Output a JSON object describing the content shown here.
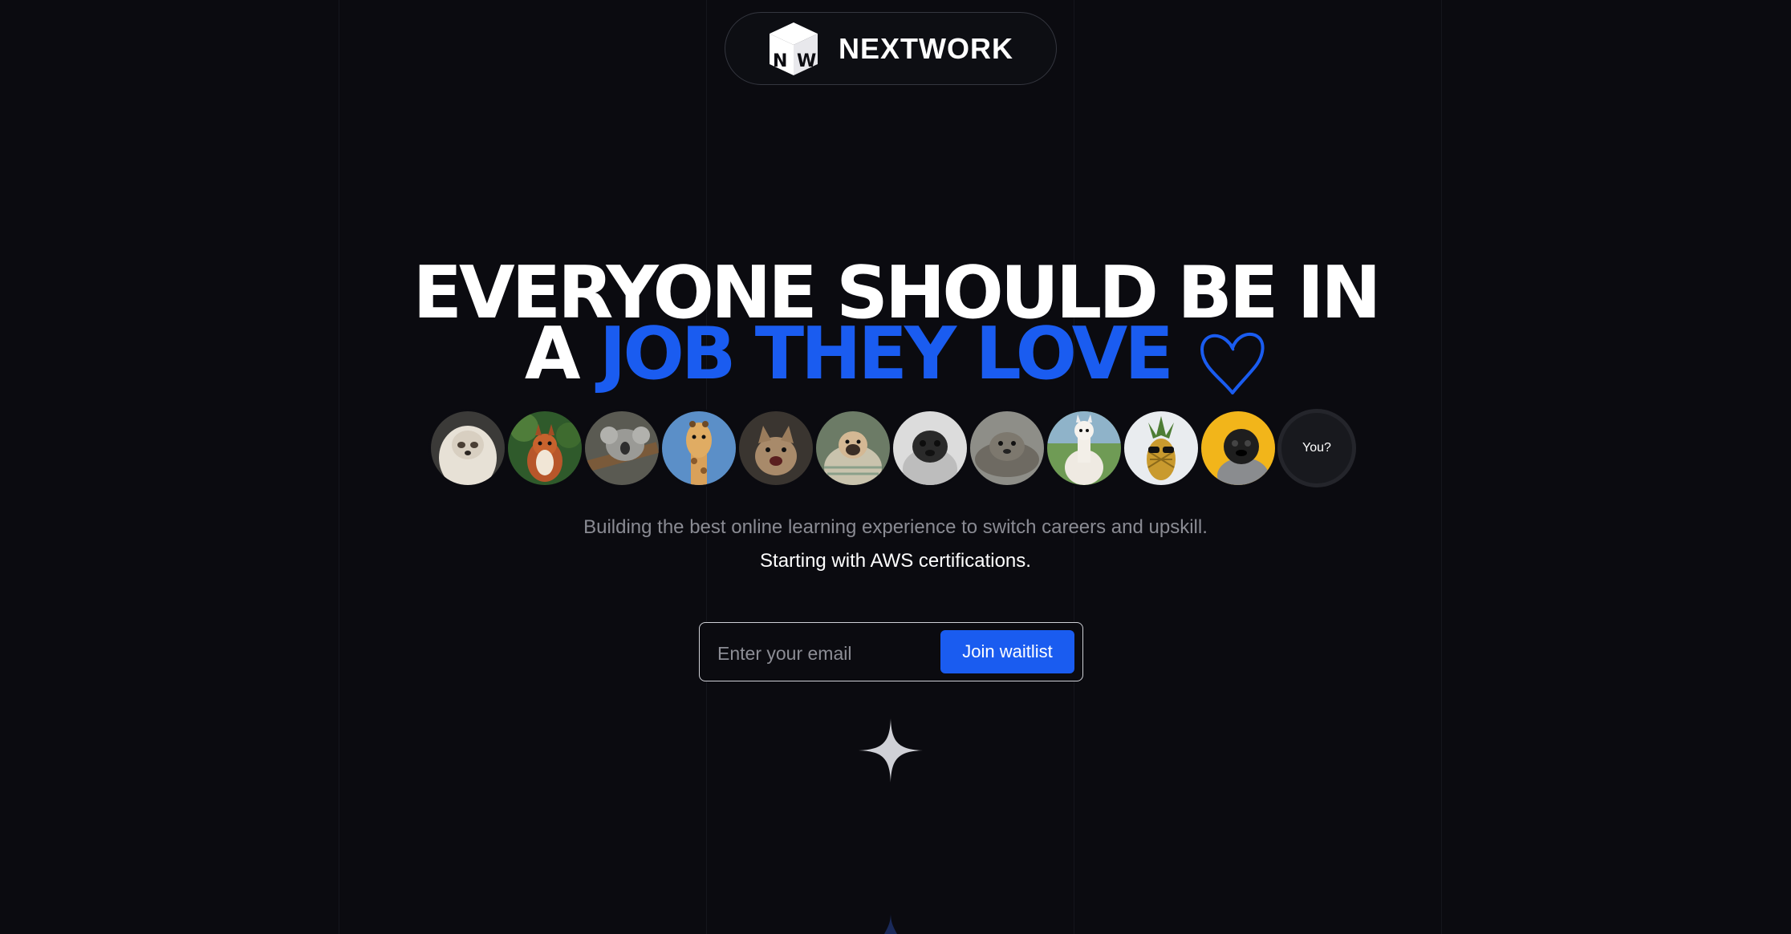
{
  "brand": {
    "name": "NEXTWORK",
    "mark_letters": [
      "N",
      "W"
    ]
  },
  "hero": {
    "headline_line1": "EVERYONE SHOULD BE IN",
    "headline_line2_prefix": "A",
    "headline_line2_accent": "JOB THEY LOVE",
    "subtitle": "Building the best online learning experience to switch careers and upskill.",
    "subtitle_emphasis": "Starting with AWS certifications."
  },
  "avatars": {
    "items": [
      "sloth",
      "squirrel",
      "koala",
      "giraffe",
      "cat",
      "pug-blanket",
      "pug",
      "seal",
      "alpaca",
      "pineapple",
      "pug-yellow"
    ],
    "you_label": "You?"
  },
  "waitlist": {
    "email_placeholder": "Enter your email",
    "button_label": "Join waitlist"
  },
  "colors": {
    "background": "#0b0b10",
    "accent": "#1a5cf0",
    "text_primary": "#ffffff",
    "text_muted": "#8a8b93"
  },
  "icons": [
    "nextwork-logo-icon",
    "heart-outline-icon",
    "sparkle-icon"
  ]
}
